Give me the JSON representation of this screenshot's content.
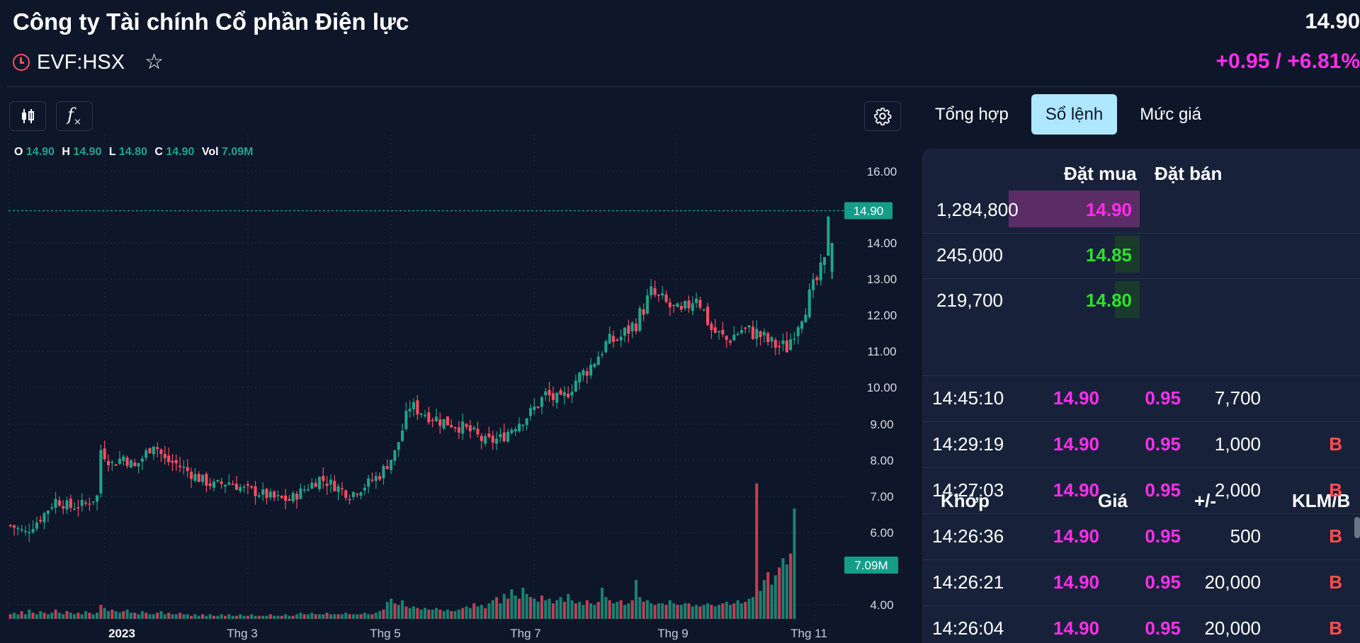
{
  "header": {
    "company_name": "Công ty Tài chính Cổ phần Điện lực",
    "price": "14.90",
    "ticker": "EVF:HSX",
    "change": "+0.95 / +6.81%"
  },
  "icons": {
    "clock": "clock-icon",
    "star": "star-icon",
    "candles": "candlestick-icon",
    "fx": "function-icon",
    "settings": "gear-icon"
  },
  "toolbar": {
    "fx_label": "f"
  },
  "ohlc": {
    "o_label": "O",
    "o": "14.90",
    "h_label": "H",
    "h": "14.90",
    "l_label": "L",
    "l": "14.80",
    "c_label": "C",
    "c": "14.90",
    "vol_label": "Vol",
    "vol": "7.09M"
  },
  "chart_data": {
    "type": "candlestick",
    "y_ticks": [
      "16.00",
      "14.00",
      "13.00",
      "12.00",
      "11.00",
      "10.00",
      "9.00",
      "8.00",
      "7.00",
      "6.00",
      "4.00"
    ],
    "x_ticks": [
      "2023",
      "Thg 3",
      "Thg 5",
      "Thg 7",
      "Thg 9",
      "Thg 11"
    ],
    "last_price_label": "14.90",
    "last_volume_label": "7.09M",
    "close_path": [
      [
        0,
        6.2
      ],
      [
        4,
        6.0
      ],
      [
        8,
        6.4
      ],
      [
        12,
        6.9
      ],
      [
        16,
        6.7
      ],
      [
        20,
        6.8
      ],
      [
        23,
        7.0
      ],
      [
        24,
        8.3
      ],
      [
        27,
        7.9
      ],
      [
        30,
        8.1
      ],
      [
        33,
        7.8
      ],
      [
        36,
        8.2
      ],
      [
        38,
        8.5
      ],
      [
        41,
        8.0
      ],
      [
        44,
        7.9
      ],
      [
        47,
        7.7
      ],
      [
        50,
        7.5
      ],
      [
        54,
        7.3
      ],
      [
        58,
        7.4
      ],
      [
        62,
        7.2
      ],
      [
        66,
        7.1
      ],
      [
        70,
        6.95
      ],
      [
        74,
        6.9
      ],
      [
        78,
        7.2
      ],
      [
        82,
        7.5
      ],
      [
        86,
        7.3
      ],
      [
        90,
        7.05
      ],
      [
        94,
        7.3
      ],
      [
        98,
        7.6
      ],
      [
        102,
        8.2
      ],
      [
        106,
        9.5
      ],
      [
        110,
        9.3
      ],
      [
        114,
        9.1
      ],
      [
        118,
        9.0
      ],
      [
        122,
        8.8
      ],
      [
        126,
        8.5
      ],
      [
        130,
        8.6
      ],
      [
        134,
        9.0
      ],
      [
        138,
        9.3
      ],
      [
        142,
        9.8
      ],
      [
        146,
        9.6
      ],
      [
        150,
        10.2
      ],
      [
        154,
        10.6
      ],
      [
        158,
        11.2
      ],
      [
        162,
        11.4
      ],
      [
        166,
        11.8
      ],
      [
        170,
        12.6
      ],
      [
        174,
        12.3
      ],
      [
        178,
        12.0
      ],
      [
        182,
        12.6
      ],
      [
        186,
        11.6
      ],
      [
        190,
        11.3
      ],
      [
        194,
        11.6
      ],
      [
        198,
        11.5
      ],
      [
        202,
        11.2
      ],
      [
        206,
        11.1
      ],
      [
        208,
        11.6
      ],
      [
        212,
        12.5
      ],
      [
        216,
        13.4
      ],
      [
        217,
        14.9
      ]
    ],
    "volume": [
      0.3,
      0.4,
      0.3,
      0.5,
      0.3,
      0.6,
      0.4,
      0.3,
      0.5,
      0.4,
      0.3,
      0.4,
      0.6,
      0.4,
      0.3,
      0.5,
      0.4,
      0.3,
      0.4,
      0.3,
      0.5,
      0.4,
      0.3,
      0.4,
      0.9,
      0.7,
      0.5,
      0.6,
      0.5,
      0.4,
      0.5,
      0.6,
      0.4,
      0.4,
      0.3,
      0.5,
      0.4,
      0.3,
      0.3,
      0.4,
      0.5,
      0.3,
      0.4,
      0.3,
      0.3,
      0.4,
      0.3,
      0.3,
      0.2,
      0.3,
      0.2,
      0.3,
      0.2,
      0.3,
      0.2,
      0.2,
      0.3,
      0.2,
      0.3,
      0.2,
      0.2,
      0.3,
      0.2,
      0.2,
      0.3,
      0.2,
      0.2,
      0.2,
      0.2,
      0.3,
      0.2,
      0.2,
      0.2,
      0.3,
      0.2,
      0.2,
      0.3,
      0.4,
      0.3,
      0.3,
      0.4,
      0.3,
      0.3,
      0.3,
      0.4,
      0.3,
      0.3,
      0.3,
      0.3,
      0.4,
      0.3,
      0.3,
      0.3,
      0.3,
      0.4,
      0.3,
      0.3,
      0.4,
      0.5,
      0.6,
      1.1,
      1.3,
      1.0,
      0.9,
      1.2,
      0.8,
      0.7,
      0.8,
      0.7,
      0.6,
      0.7,
      0.6,
      0.6,
      0.7,
      0.6,
      0.5,
      0.6,
      0.5,
      0.5,
      0.6,
      0.7,
      0.8,
      0.7,
      1.0,
      0.8,
      0.9,
      0.7,
      1.0,
      1.2,
      1.4,
      1.0,
      1.6,
      1.3,
      1.9,
      1.5,
      1.3,
      2.0,
      1.6,
      1.4,
      1.3,
      1.1,
      1.5,
      1.2,
      1.3,
      1.0,
      1.2,
      1.4,
      1.1,
      1.6,
      1.2,
      1.0,
      1.1,
      0.9,
      1.2,
      1.0,
      0.9,
      1.1,
      2.0,
      1.4,
      1.2,
      1.0,
      1.1,
      1.2,
      0.9,
      1.0,
      1.2,
      2.5,
      1.4,
      1.1,
      1.2,
      1.0,
      0.9,
      1.0,
      1.0,
      0.9,
      1.2,
      1.0,
      0.9,
      0.9,
      1.0,
      1.0,
      0.8,
      0.9,
      0.8,
      0.9,
      1.0,
      0.9,
      0.8,
      0.9,
      1.0,
      1.1,
      0.9,
      1.0,
      1.2,
      1.0,
      1.1,
      1.3,
      1.4,
      8.7,
      1.8,
      2.5,
      3.0,
      2.2,
      2.8,
      3.3,
      3.9,
      3.5,
      4.2,
      7.09
    ]
  },
  "tabs": [
    {
      "label": "Tổng hợp",
      "active": false
    },
    {
      "label": "Sổ lệnh",
      "active": true
    },
    {
      "label": "Mức giá",
      "active": false
    }
  ],
  "order_book": {
    "bid_header": "Đặt mua",
    "ask_header": "Đặt bán",
    "bids": [
      {
        "qty": "1,284,800",
        "price": "14.90",
        "color": "#ff2ee9"
      },
      {
        "qty": "245,000",
        "price": "14.85",
        "color": "#2ee02e"
      },
      {
        "qty": "219,700",
        "price": "14.80",
        "color": "#2ee02e"
      }
    ]
  },
  "trades": {
    "headers": {
      "time": "Khớp",
      "price": "Giá",
      "change": "+/-",
      "volume": "KLM/B"
    },
    "rows": [
      {
        "time": "14:45:10",
        "price": "14.90",
        "change": "0.95",
        "volume": "7,700",
        "side": ""
      },
      {
        "time": "14:29:19",
        "price": "14.90",
        "change": "0.95",
        "volume": "1,000",
        "side": "B"
      },
      {
        "time": "14:27:03",
        "price": "14.90",
        "change": "0.95",
        "volume": "2,000",
        "side": "B"
      },
      {
        "time": "14:26:36",
        "price": "14.90",
        "change": "0.95",
        "volume": "500",
        "side": "B"
      },
      {
        "time": "14:26:21",
        "price": "14.90",
        "change": "0.95",
        "volume": "20,000",
        "side": "B"
      },
      {
        "time": "14:26:04",
        "price": "14.90",
        "change": "0.95",
        "volume": "20,000",
        "side": "B"
      }
    ]
  },
  "colors": {
    "up": "#1fa58a",
    "down": "#ff4d62",
    "accent_magenta": "#ff2ee9",
    "tab_active": "#aee7ff"
  }
}
